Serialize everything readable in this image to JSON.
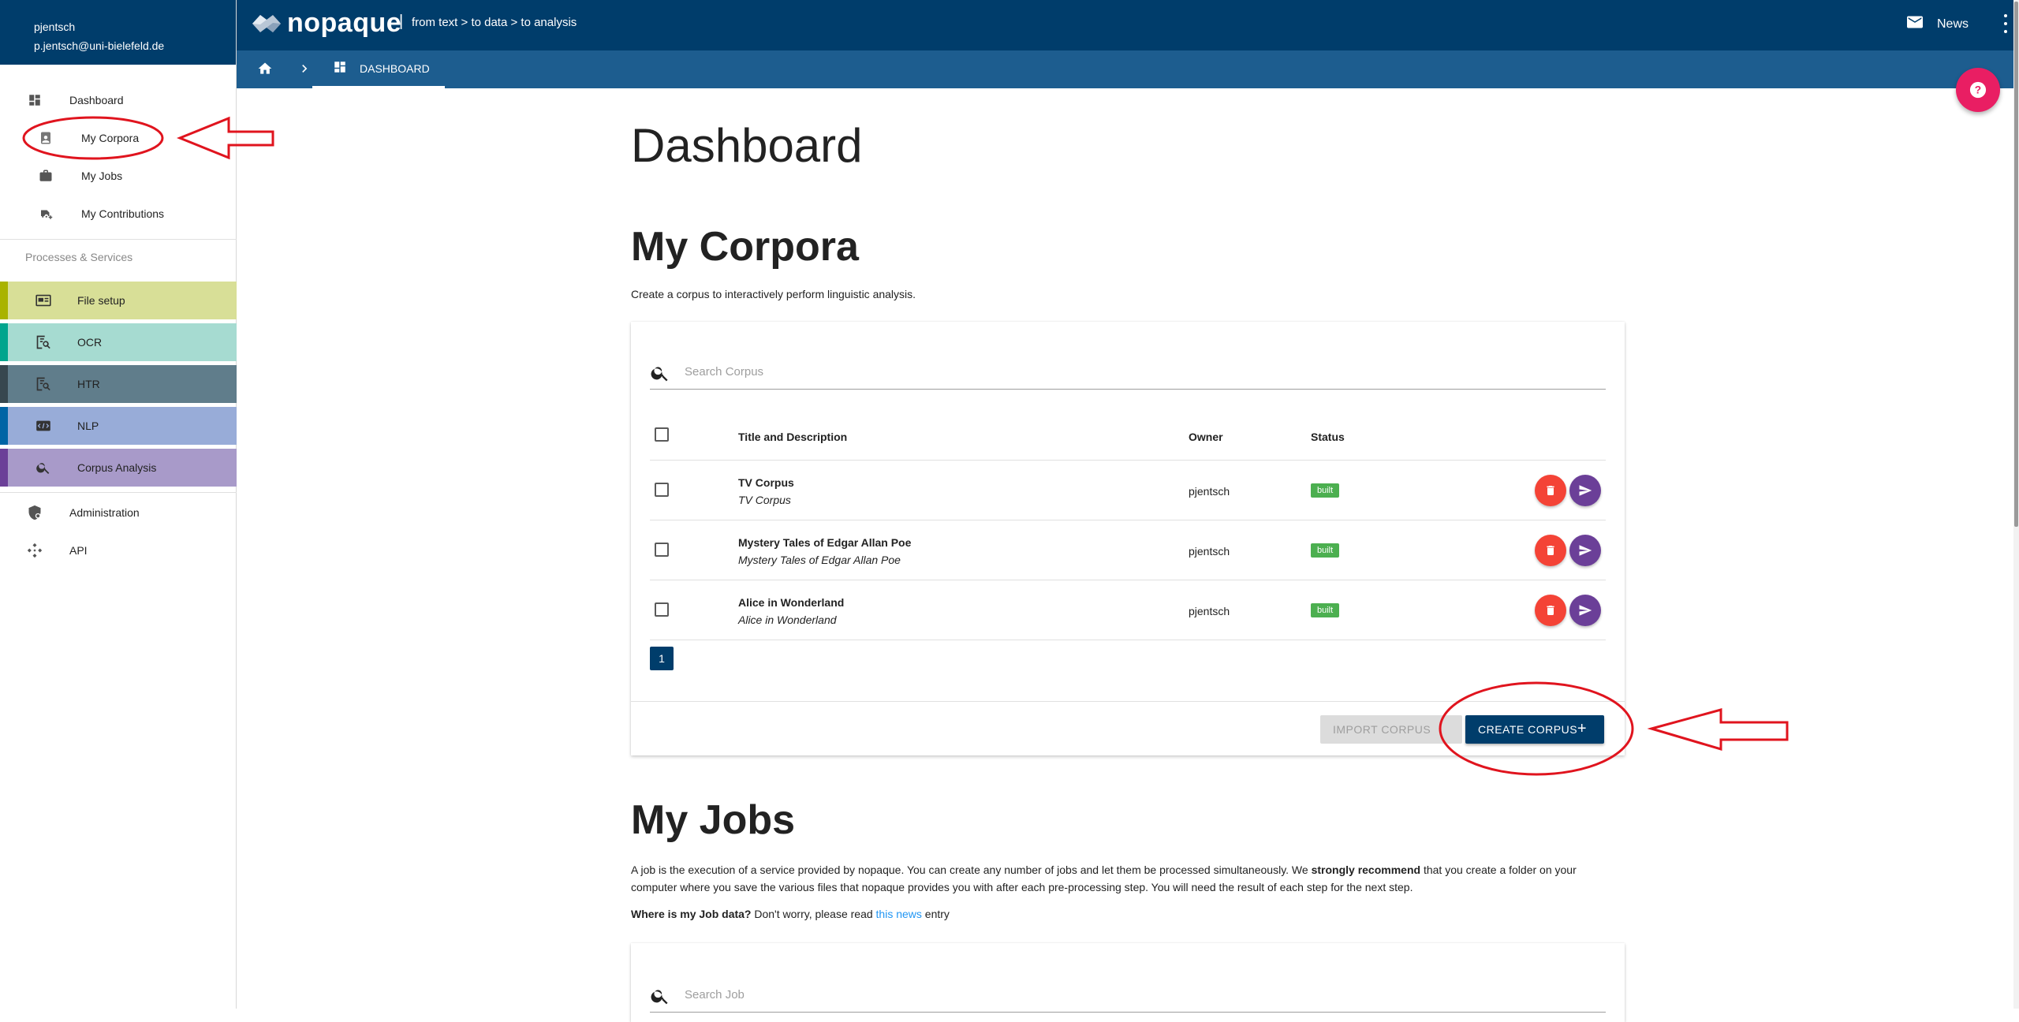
{
  "user": {
    "name": "pjentsch",
    "email": "p.jentsch@uni-bielefeld.de"
  },
  "sidebar": {
    "items": [
      {
        "label": "Dashboard",
        "icon": "dashboard-icon"
      },
      {
        "label": "My Corpora",
        "icon": "corpus-book-icon"
      },
      {
        "label": "My Jobs",
        "icon": "briefcase-icon"
      },
      {
        "label": "My Contributions",
        "icon": "contributions-icon"
      }
    ],
    "services_header": "Processes & Services",
    "services": [
      {
        "label": "File setup",
        "color": "#a9b300",
        "bg": "#d8df97",
        "icon": "file-setup-icon"
      },
      {
        "label": "OCR",
        "color": "#00a58d",
        "bg": "#a6dbd1",
        "icon": "ocr-icon"
      },
      {
        "label": "HTR",
        "color": "#37474f",
        "bg": "#607d8b",
        "icon": "htr-icon"
      },
      {
        "label": "NLP",
        "color": "#0064a5",
        "bg": "#98acd8",
        "icon": "nlp-icon"
      },
      {
        "label": "Corpus Analysis",
        "color": "#6b3f98",
        "bg": "#a89ac9",
        "icon": "search-icon"
      }
    ],
    "admin": [
      {
        "label": "Administration",
        "icon": "admin-shield-icon"
      },
      {
        "label": "API",
        "icon": "api-icon"
      }
    ]
  },
  "topbar": {
    "logo_text": "nopaque",
    "separator": "|",
    "slogan": "from text > to data > to analysis",
    "news_label": "News"
  },
  "breadcrumb": {
    "current": "DASHBOARD"
  },
  "main": {
    "title": "Dashboard",
    "corpora": {
      "heading": "My Corpora",
      "description": "Create a corpus to interactively perform linguistic analysis.",
      "search_placeholder": "Search Corpus",
      "columns": {
        "title": "Title and Description",
        "owner": "Owner",
        "status": "Status"
      },
      "rows": [
        {
          "title": "TV Corpus",
          "description": "TV Corpus",
          "owner": "pjentsch",
          "status": "built"
        },
        {
          "title": "Mystery Tales of Edgar Allan Poe",
          "description": "Mystery Tales of Edgar Allan Poe",
          "owner": "pjentsch",
          "status": "built"
        },
        {
          "title": "Alice in Wonderland",
          "description": "Alice in Wonderland",
          "owner": "pjentsch",
          "status": "built"
        }
      ],
      "page": "1",
      "import_label": "IMPORT CORPUS",
      "create_label": "CREATE CORPUS",
      "create_icon": "+"
    },
    "jobs": {
      "heading": "My Jobs",
      "desc_part1": "A job is the execution of a service provided by nopaque. You can create any number of jobs and let them be processed simultaneously. We ",
      "desc_strong": "strongly recommend",
      "desc_part2": " that you create a folder on your computer where you save the various files that nopaque provides you with after each pre-processing step. You will need the result of each step for the next step.",
      "where_q": "Where is my Job data?",
      "where_text": " Don't worry, please read ",
      "where_link": "this news",
      "where_end": " entry",
      "search_placeholder": "Search Job"
    }
  },
  "colors": {
    "primary": "#003d6b",
    "breadcrumb": "#1d5d8f",
    "fab": "#e91e63",
    "delete": "#f44336",
    "share": "#6b3f98",
    "badge": "#4caf50",
    "annotation": "#e0141e"
  }
}
